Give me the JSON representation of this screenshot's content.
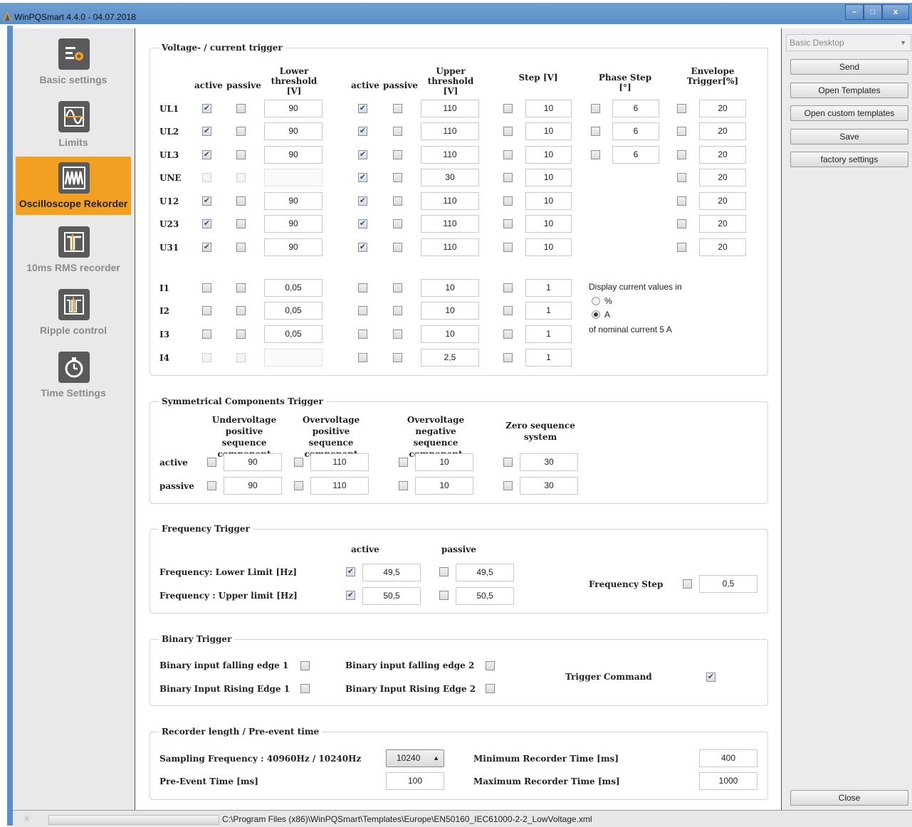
{
  "window": {
    "title": "WinPQSmart  4.4.0 - 04.07.2018",
    "minimize": "–",
    "maximize": "□",
    "close": "x"
  },
  "sidebar": {
    "items": [
      {
        "label": "Basic settings",
        "icon": "settings-icon",
        "active": false
      },
      {
        "label": "Limits",
        "icon": "waveform-limits-icon",
        "active": false
      },
      {
        "label": "Oscilloscope Rekorder",
        "icon": "oscilloscope-icon",
        "active": true
      },
      {
        "label": "10ms RMS recorder",
        "icon": "rms-recorder-icon",
        "active": false
      },
      {
        "label": "Ripple control",
        "icon": "ripple-control-icon",
        "active": false
      },
      {
        "label": "Time Settings",
        "icon": "stopwatch-icon",
        "active": false
      }
    ]
  },
  "right_panel": {
    "profile_select": "Basic Desktop",
    "buttons": {
      "send": "Send",
      "open_templates": "Open Templates",
      "open_custom": "Open custom templates",
      "save": "Save",
      "factory": "factory settings",
      "close": "Close"
    }
  },
  "vc_trigger": {
    "title": "Voltage- / current trigger",
    "headers": {
      "active": "active",
      "passive": "passive",
      "lower": "Lower threshold\n[V]",
      "upper": "Upper threshold\n[V]",
      "step": "Step [V]",
      "phase_step": "Phase Step [°]",
      "envelope": "Envelope\nTrigger[%]"
    },
    "rows": [
      {
        "name": "UL1",
        "lower": "90",
        "upper": "110",
        "step": "10",
        "phase": "6",
        "env": "20"
      },
      {
        "name": "UL2",
        "lower": "90",
        "upper": "110",
        "step": "10",
        "phase": "6",
        "env": "20"
      },
      {
        "name": "UL3",
        "lower": "90",
        "upper": "110",
        "step": "10",
        "phase": "6",
        "env": "20"
      },
      {
        "name": "UNE",
        "lower": "",
        "upper": "30",
        "step": "10",
        "phase": "",
        "env": "20"
      },
      {
        "name": "U12",
        "lower": "90",
        "upper": "110",
        "step": "10",
        "phase": "",
        "env": "20"
      },
      {
        "name": "U23",
        "lower": "90",
        "upper": "110",
        "step": "10",
        "phase": "",
        "env": "20"
      },
      {
        "name": "U31",
        "lower": "90",
        "upper": "110",
        "step": "10",
        "phase": "",
        "env": "20"
      },
      {
        "name": "I1",
        "lower": "0,05",
        "upper": "10",
        "step": "1"
      },
      {
        "name": "I2",
        "lower": "0,05",
        "upper": "10",
        "step": "1"
      },
      {
        "name": "I3",
        "lower": "0,05",
        "upper": "10",
        "step": "1"
      },
      {
        "name": "I4",
        "lower": "",
        "upper": "2,5",
        "step": "1"
      }
    ],
    "display_current": {
      "label": "Display current values in",
      "opt_percent": "%",
      "opt_a": "A",
      "selected": "A",
      "nominal": "of nominal current 5 A"
    }
  },
  "sym_trigger": {
    "title": "Symmetrical Components Trigger",
    "headers": [
      "Undervoltage\npositive sequence\ncomponent",
      "Overvoltage\npositive sequence\ncomponent",
      "Overvoltage\nnegative sequence\ncomponent",
      "Zero sequence\nsystem"
    ],
    "rows": [
      {
        "label": "active",
        "values": [
          "90",
          "110",
          "10",
          "30"
        ]
      },
      {
        "label": "passive",
        "values": [
          "90",
          "110",
          "10",
          "30"
        ]
      }
    ]
  },
  "freq_trigger": {
    "title": "Frequency Trigger",
    "col_active": "active",
    "col_passive": "passive",
    "lower_label": "Frequency: Lower Limit [Hz]",
    "upper_label": "Frequency : Upper limit [Hz]",
    "lower_active": "49,5",
    "lower_passive": "49,5",
    "upper_active": "50,5",
    "upper_passive": "50,5",
    "step_label": "Frequency Step",
    "step_value": "0,5"
  },
  "binary_trigger": {
    "title": "Binary Trigger",
    "fall1": "Binary input falling edge 1",
    "rise1": "Binary Input Rising Edge 1",
    "fall2": "Binary input falling edge 2",
    "rise2": "Binary Input Rising Edge 2",
    "command": "Trigger Command"
  },
  "recorder": {
    "title": "Recorder length / Pre-event time",
    "sampling_label": "Sampling Frequency : 40960Hz / 10240Hz",
    "sampling_value": "10240",
    "pre_event_label": "Pre-Event Time [ms]",
    "pre_event_value": "100",
    "min_label": "Minimum Recorder Time [ms]",
    "min_value": "400",
    "max_label": "Maximum Recorder Time [ms]",
    "max_value": "1000"
  },
  "status": {
    "path": "C:\\Program Files (x86)\\WinPQSmart\\Templates\\Europe\\EN50160_IEC61000-2-2_LowVoltage.xml"
  }
}
